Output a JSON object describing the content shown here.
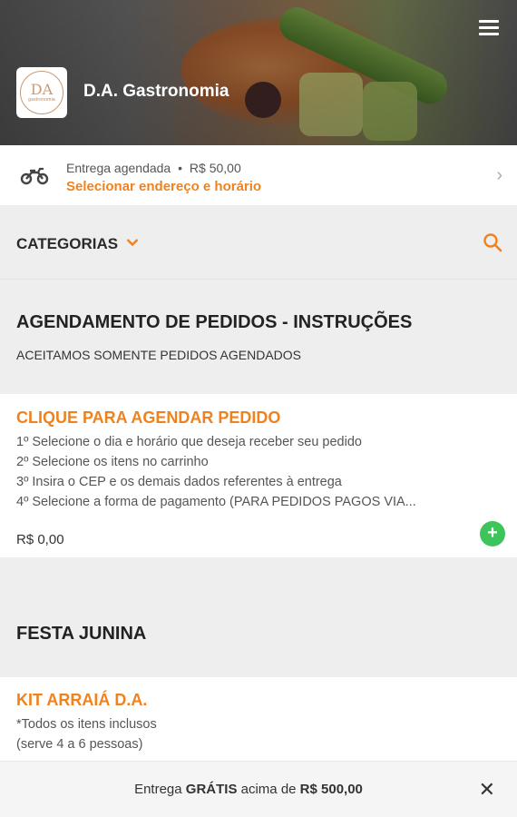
{
  "header": {
    "store_name": "D.A. Gastronomia",
    "logo_text": "DA",
    "logo_subtext": "gastronomia"
  },
  "delivery": {
    "mode": "Entrega agendada",
    "separator": "•",
    "fee": "R$ 50,00",
    "action": "Selecionar endereço e horário"
  },
  "categories": {
    "label": "CATEGORIAS"
  },
  "sections": [
    {
      "title": "AGENDAMENTO DE PEDIDOS - INSTRUÇÕES",
      "subtitle": "ACEITAMOS SOMENTE PEDIDOS AGENDADOS",
      "products": [
        {
          "name": "CLIQUE PARA AGENDAR PEDIDO",
          "lines": [
            "1º Selecione o dia e horário que deseja receber seu pedido",
            "2º Selecione os itens no carrinho",
            "3º Insira o CEP e os demais dados referentes à entrega",
            "4º Selecione a forma de pagamento (PARA PEDIDOS PAGOS VIA..."
          ],
          "price": "R$ 0,00"
        }
      ]
    },
    {
      "title": "FESTA JUNINA",
      "products": [
        {
          "name": "KIT ARRAIÁ D.A.",
          "lines": [
            "*Todos os itens inclusos",
            "(serve 4 a 6 pessoas)"
          ]
        }
      ]
    }
  ],
  "banner": {
    "prefix": "Entrega ",
    "free": "GRÁTIS",
    "middle": " acima de ",
    "amount": "R$ 500,00"
  },
  "colors": {
    "accent": "#f0821e",
    "add_button": "#3dc45a"
  },
  "icons": [
    "menu-icon",
    "motorcycle-icon",
    "chevron-right-icon",
    "chevron-down-icon",
    "search-icon",
    "plus-icon",
    "close-icon"
  ]
}
